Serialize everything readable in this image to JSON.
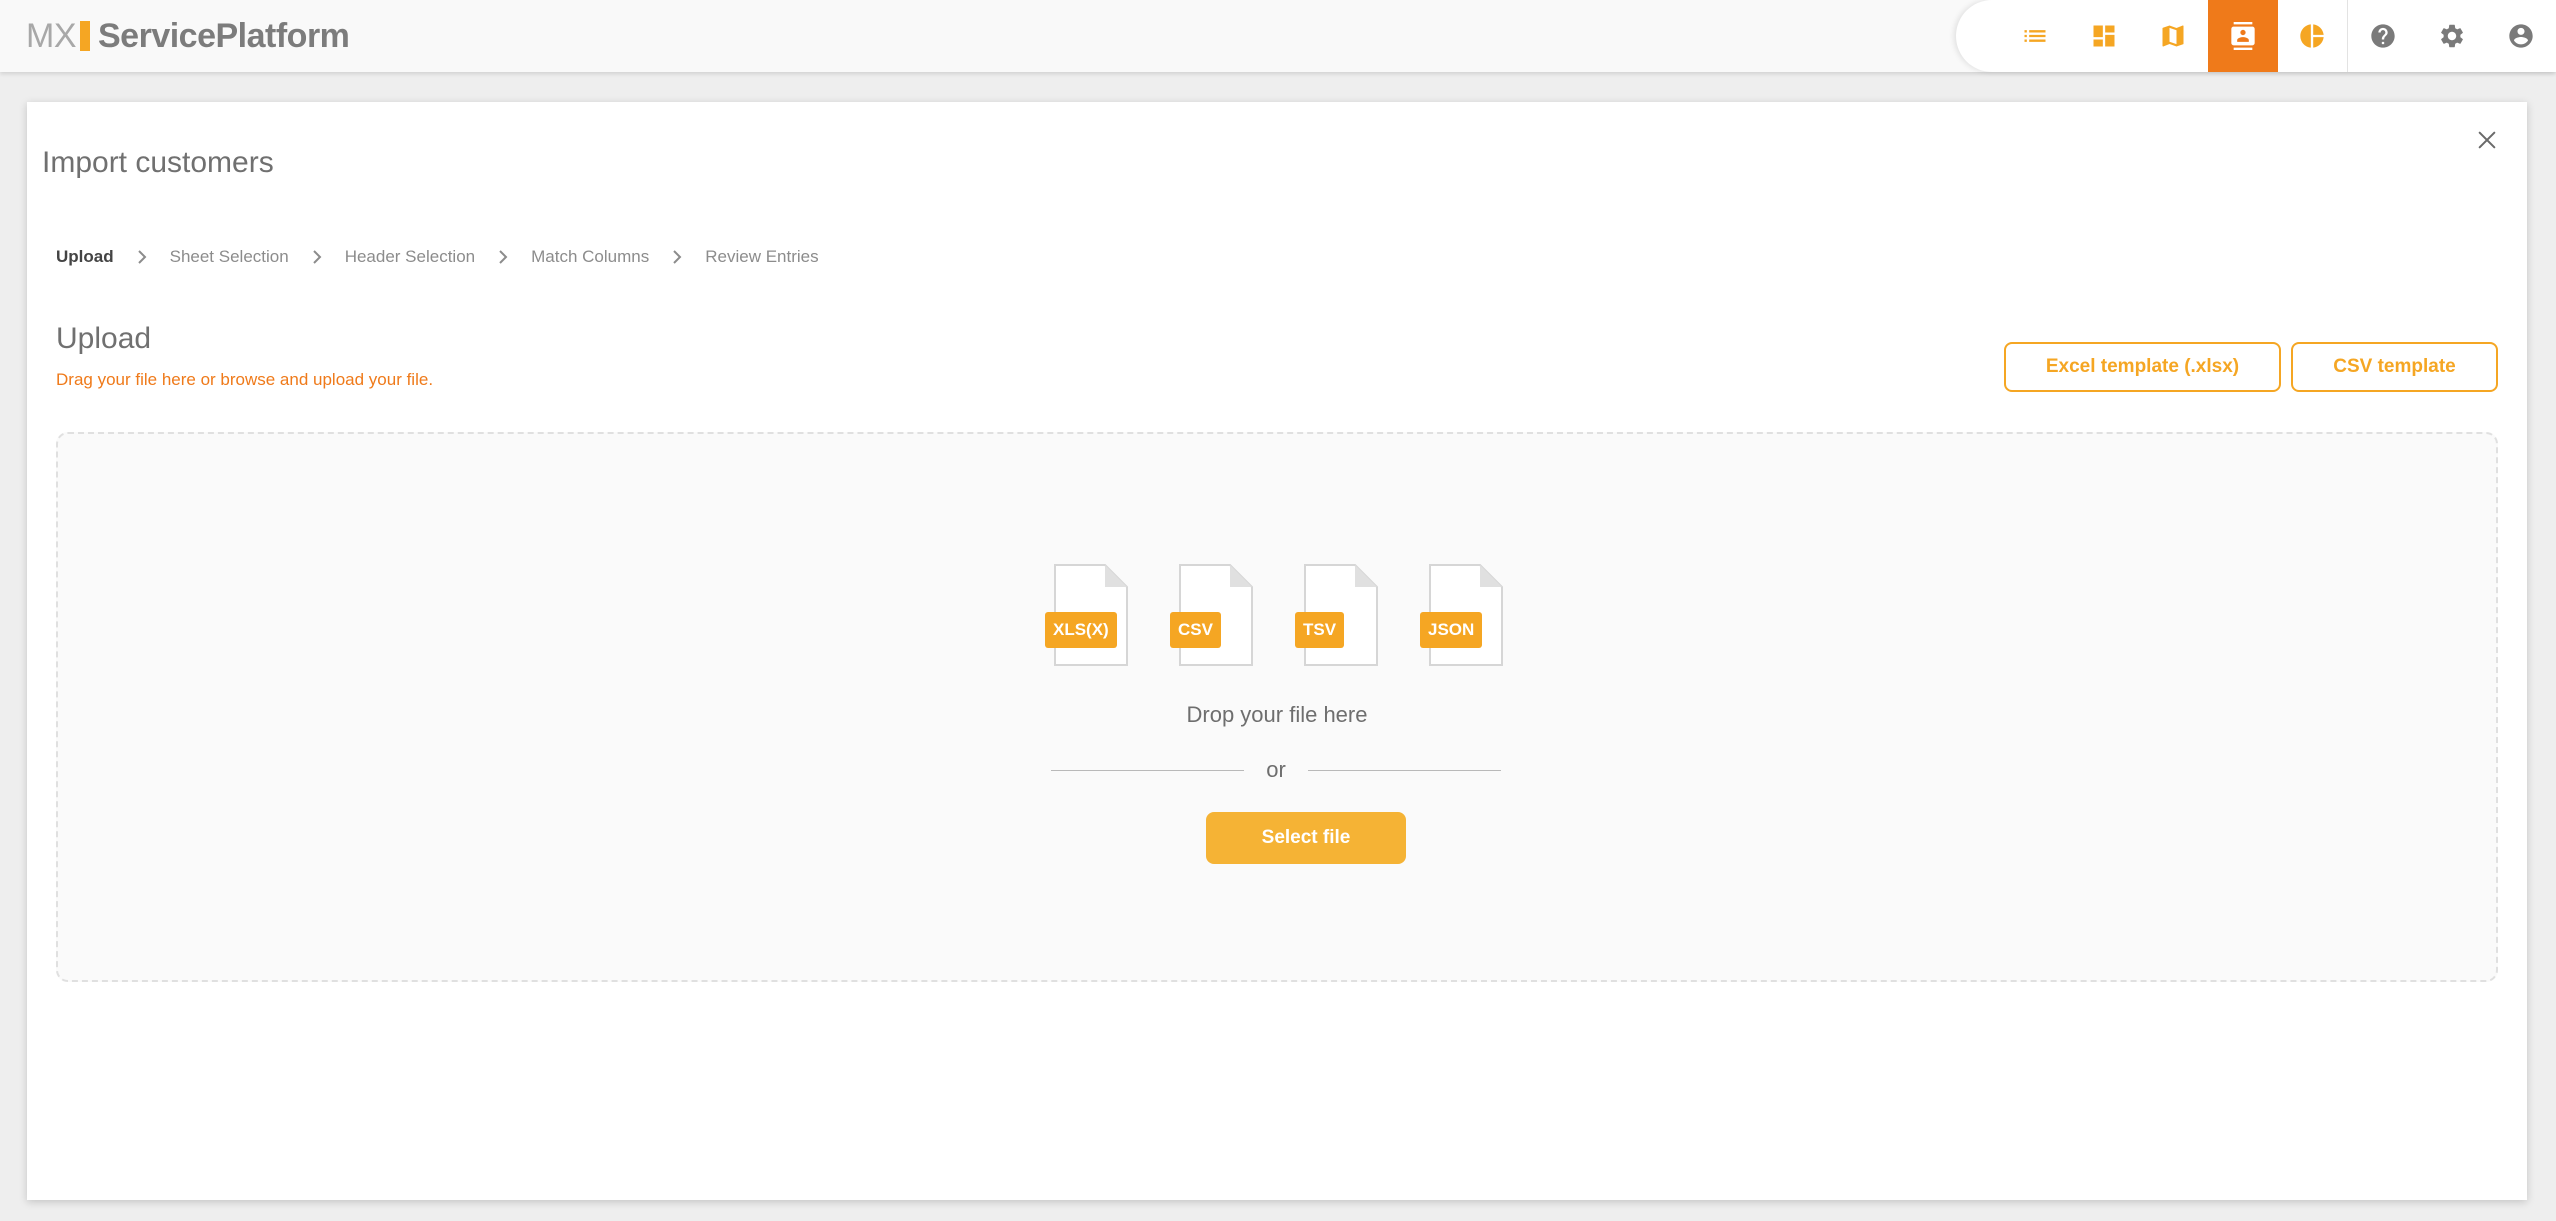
{
  "app": {
    "logo_prefix": "MX",
    "logo_name": "ServicePlatform"
  },
  "nav": {
    "items": [
      {
        "icon": "list-icon",
        "active": false
      },
      {
        "icon": "dashboard-icon",
        "active": false
      },
      {
        "icon": "map-icon",
        "active": false
      },
      {
        "icon": "contacts-icon",
        "active": true
      },
      {
        "icon": "pie-chart-icon",
        "active": false
      },
      {
        "icon": "help-icon",
        "active": false
      },
      {
        "icon": "gear-icon",
        "active": false
      },
      {
        "icon": "account-icon",
        "active": false
      }
    ]
  },
  "dialog": {
    "title": "Import customers",
    "steps": [
      "Upload",
      "Sheet Selection",
      "Header Selection",
      "Match Columns",
      "Review Entries"
    ],
    "current_step": "Upload"
  },
  "upload": {
    "title": "Upload",
    "subtitle": "Drag your file here or browse and upload your file.",
    "excel_template_label": "Excel template (.xlsx)",
    "csv_template_label": "CSV template",
    "file_types": [
      "XLS(X)",
      "CSV",
      "TSV",
      "JSON"
    ],
    "drop_text": "Drop your file here",
    "or_text": "or",
    "select_file_label": "Select file"
  },
  "colors": {
    "accent": "#f5a623",
    "active_nav": "#ef7a1a",
    "subtitle": "#ef7a1a"
  }
}
